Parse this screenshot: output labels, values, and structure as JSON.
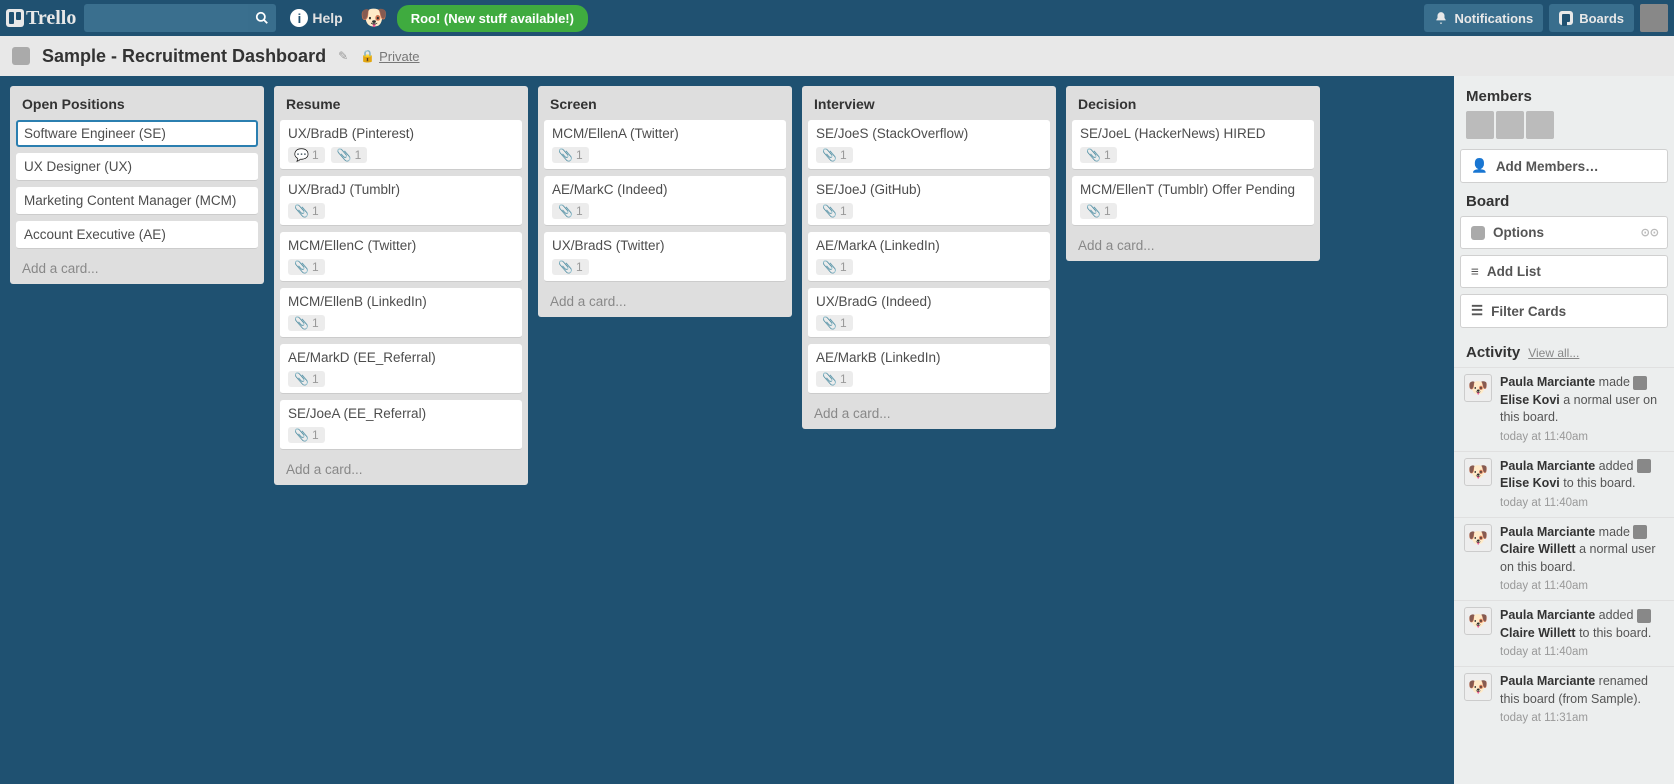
{
  "header": {
    "logo": "Trello",
    "help": "Help",
    "roo_banner": "Roo! (New stuff available!)",
    "notifications": "Notifications",
    "boards": "Boards"
  },
  "board": {
    "title": "Sample - Recruitment Dashboard",
    "privacy": "Private"
  },
  "lists": [
    {
      "name": "Open Positions",
      "add": "Add a card...",
      "cards": [
        {
          "title": "Software Engineer (SE)",
          "selected": true
        },
        {
          "title": "UX Designer (UX)"
        },
        {
          "title": "Marketing Content Manager (MCM)"
        },
        {
          "title": "Account Executive (AE)"
        }
      ]
    },
    {
      "name": "Resume",
      "add": "Add a card...",
      "cards": [
        {
          "title": "UX/BradB (Pinterest)",
          "comments": 1,
          "attachments": 1
        },
        {
          "title": "UX/BradJ (Tumblr)",
          "attachments": 1
        },
        {
          "title": "MCM/EllenC (Twitter)",
          "attachments": 1
        },
        {
          "title": "MCM/EllenB (LinkedIn)",
          "attachments": 1
        },
        {
          "title": "AE/MarkD (EE_Referral)",
          "attachments": 1
        },
        {
          "title": "SE/JoeA (EE_Referral)",
          "attachments": 1
        }
      ]
    },
    {
      "name": "Screen",
      "add": "Add a card...",
      "cards": [
        {
          "title": "MCM/EllenA (Twitter)",
          "attachments": 1
        },
        {
          "title": "AE/MarkC (Indeed)",
          "attachments": 1
        },
        {
          "title": "UX/BradS (Twitter)",
          "attachments": 1
        }
      ]
    },
    {
      "name": "Interview",
      "add": "Add a card...",
      "cards": [
        {
          "title": "SE/JoeS (StackOverflow)",
          "attachments": 1
        },
        {
          "title": "SE/JoeJ (GitHub)",
          "attachments": 1
        },
        {
          "title": "AE/MarkA (LinkedIn)",
          "attachments": 1
        },
        {
          "title": "UX/BradG (Indeed)",
          "attachments": 1
        },
        {
          "title": "AE/MarkB (LinkedIn)",
          "attachments": 1
        }
      ]
    },
    {
      "name": "Decision",
      "add": "Add a card...",
      "cards": [
        {
          "title": "SE/JoeL (HackerNews) HIRED",
          "attachments": 1
        },
        {
          "title": "MCM/EllenT (Tumblr) Offer Pending",
          "attachments": 1
        }
      ]
    }
  ],
  "sidebar": {
    "members_title": "Members",
    "add_members": "Add Members…",
    "board_title": "Board",
    "options": "Options",
    "add_list": "Add List",
    "filter": "Filter Cards",
    "activity_title": "Activity",
    "view_all": "View all...",
    "activity": [
      {
        "actor": "Paula Marciante",
        "verb": " made ",
        "target": "Elise Kovi",
        "rest": " a normal user on this board.",
        "time": "today at 11:40am"
      },
      {
        "actor": "Paula Marciante",
        "verb": " added ",
        "target": "Elise Kovi",
        "rest": " to this board.",
        "time": "today at 11:40am"
      },
      {
        "actor": "Paula Marciante",
        "verb": " made ",
        "target": "Claire Willett",
        "rest": " a normal user on this board.",
        "time": "today at 11:40am"
      },
      {
        "actor": "Paula Marciante",
        "verb": " added ",
        "target": "Claire Willett",
        "rest": " to this board.",
        "time": "today at 11:40am"
      },
      {
        "actor": "Paula Marciante",
        "verb": " renamed this board (from Sample).",
        "target": "",
        "rest": "",
        "time": "today at 11:31am"
      }
    ]
  }
}
